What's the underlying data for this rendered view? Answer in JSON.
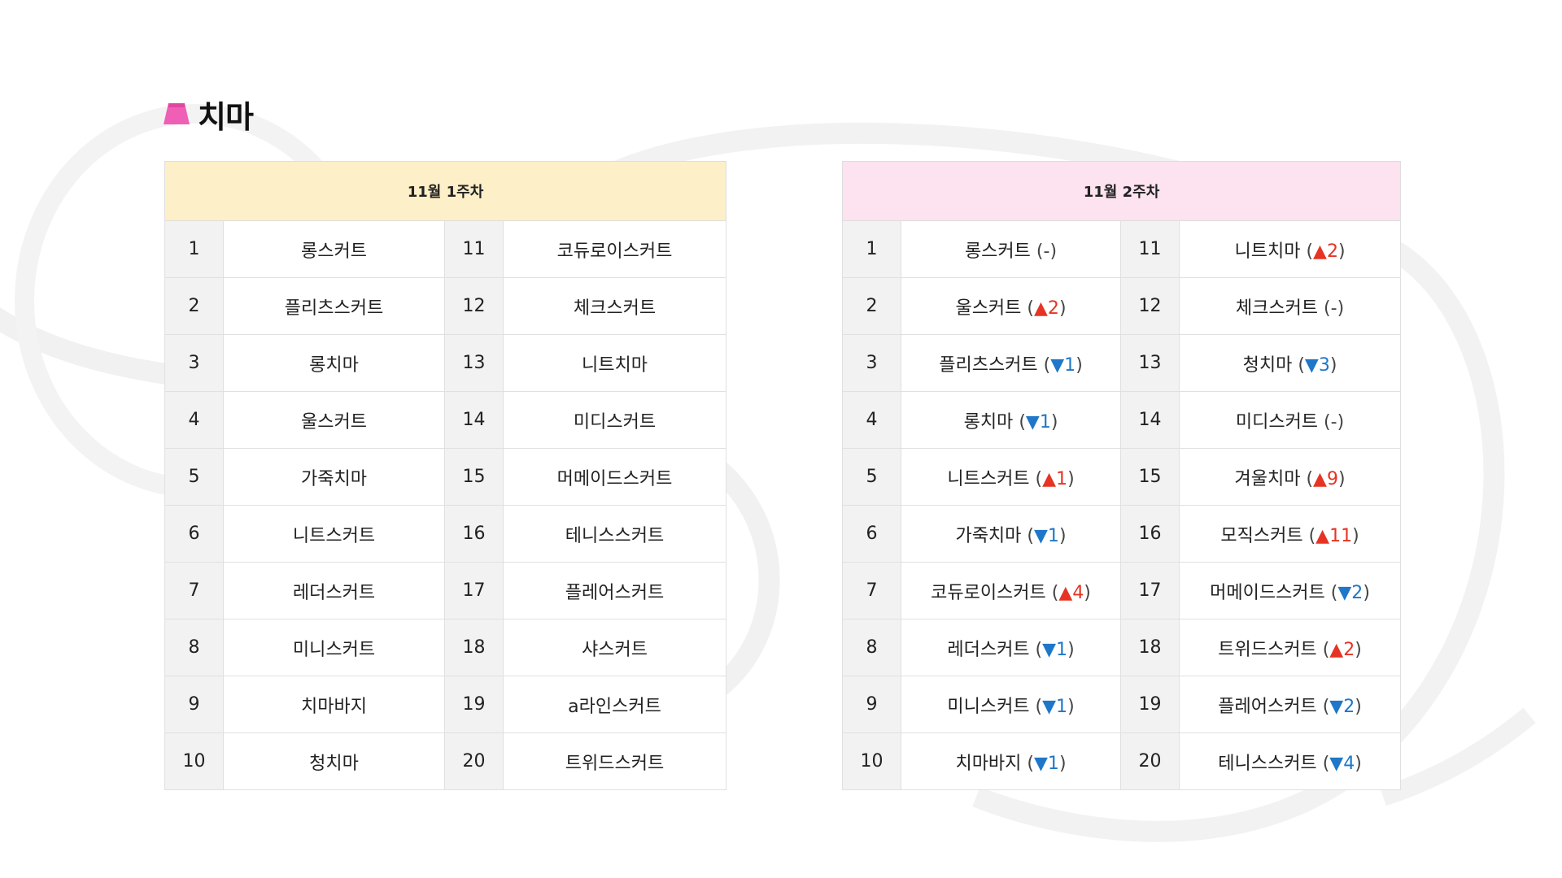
{
  "section": {
    "title": "치마",
    "icon": "skirt-icon"
  },
  "colors": {
    "up": "#e53424",
    "down": "#1e77c8",
    "week1_header": "#fdefc7",
    "week2_header": "#fde2ef"
  },
  "week1": {
    "header": "11월 1주차",
    "left": [
      {
        "rank": "1",
        "name": "롱스커트"
      },
      {
        "rank": "2",
        "name": "플리츠스커트"
      },
      {
        "rank": "3",
        "name": "롱치마"
      },
      {
        "rank": "4",
        "name": "울스커트"
      },
      {
        "rank": "5",
        "name": "가죽치마"
      },
      {
        "rank": "6",
        "name": "니트스커트"
      },
      {
        "rank": "7",
        "name": "레더스커트"
      },
      {
        "rank": "8",
        "name": "미니스커트"
      },
      {
        "rank": "9",
        "name": "치마바지"
      },
      {
        "rank": "10",
        "name": "청치마"
      }
    ],
    "right": [
      {
        "rank": "11",
        "name": "코듀로이스커트"
      },
      {
        "rank": "12",
        "name": "체크스커트"
      },
      {
        "rank": "13",
        "name": "니트치마"
      },
      {
        "rank": "14",
        "name": "미디스커트"
      },
      {
        "rank": "15",
        "name": "머메이드스커트"
      },
      {
        "rank": "16",
        "name": "테니스스커트"
      },
      {
        "rank": "17",
        "name": "플레어스커트"
      },
      {
        "rank": "18",
        "name": "샤스커트"
      },
      {
        "rank": "19",
        "name": "a라인스커트"
      },
      {
        "rank": "20",
        "name": "트위드스커트"
      }
    ]
  },
  "week2": {
    "header": "11월 2주차",
    "left": [
      {
        "rank": "1",
        "name": "롱스커트",
        "change": "-",
        "dir": "same"
      },
      {
        "rank": "2",
        "name": "울스커트",
        "change": "▲2",
        "dir": "up"
      },
      {
        "rank": "3",
        "name": "플리츠스커트",
        "change": "▼1",
        "dir": "down"
      },
      {
        "rank": "4",
        "name": "롱치마",
        "change": "▼1",
        "dir": "down"
      },
      {
        "rank": "5",
        "name": "니트스커트",
        "change": "▲1",
        "dir": "up"
      },
      {
        "rank": "6",
        "name": "가죽치마",
        "change": "▼1",
        "dir": "down"
      },
      {
        "rank": "7",
        "name": "코듀로이스커트",
        "change": "▲4",
        "dir": "up"
      },
      {
        "rank": "8",
        "name": "레더스커트",
        "change": "▼1",
        "dir": "down"
      },
      {
        "rank": "9",
        "name": "미니스커트",
        "change": "▼1",
        "dir": "down"
      },
      {
        "rank": "10",
        "name": "치마바지",
        "change": "▼1",
        "dir": "down"
      }
    ],
    "right": [
      {
        "rank": "11",
        "name": "니트치마",
        "change": "▲2",
        "dir": "up"
      },
      {
        "rank": "12",
        "name": "체크스커트",
        "change": "-",
        "dir": "same"
      },
      {
        "rank": "13",
        "name": "청치마",
        "change": "▼3",
        "dir": "down"
      },
      {
        "rank": "14",
        "name": "미디스커트",
        "change": "-",
        "dir": "same"
      },
      {
        "rank": "15",
        "name": "겨울치마",
        "change": "▲9",
        "dir": "up"
      },
      {
        "rank": "16",
        "name": "모직스커트",
        "change": "▲11",
        "dir": "up"
      },
      {
        "rank": "17",
        "name": "머메이드스커트",
        "change": "▼2",
        "dir": "down"
      },
      {
        "rank": "18",
        "name": "트위드스커트",
        "change": "▲2",
        "dir": "up"
      },
      {
        "rank": "19",
        "name": "플레어스커트",
        "change": "▼2",
        "dir": "down"
      },
      {
        "rank": "20",
        "name": "테니스스커트",
        "change": "▼4",
        "dir": "down"
      }
    ]
  }
}
